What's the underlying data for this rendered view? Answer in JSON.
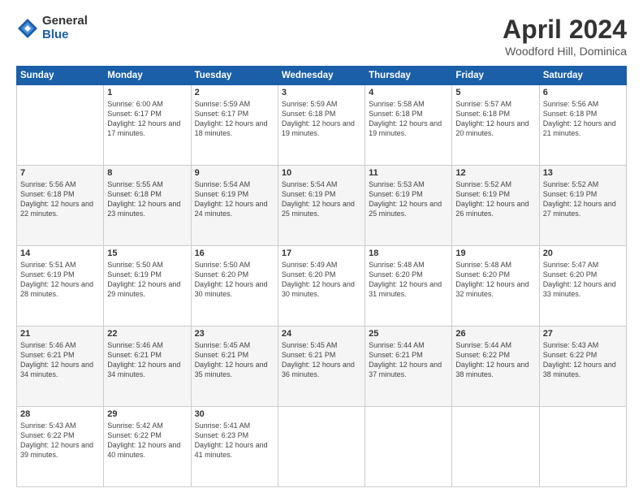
{
  "logo": {
    "general": "General",
    "blue": "Blue"
  },
  "title": {
    "month": "April 2024",
    "location": "Woodford Hill, Dominica"
  },
  "headers": [
    "Sunday",
    "Monday",
    "Tuesday",
    "Wednesday",
    "Thursday",
    "Friday",
    "Saturday"
  ],
  "weeks": [
    [
      {
        "day": "",
        "sunrise": "",
        "sunset": "",
        "daylight": ""
      },
      {
        "day": "1",
        "sunrise": "Sunrise: 6:00 AM",
        "sunset": "Sunset: 6:17 PM",
        "daylight": "Daylight: 12 hours and 17 minutes."
      },
      {
        "day": "2",
        "sunrise": "Sunrise: 5:59 AM",
        "sunset": "Sunset: 6:17 PM",
        "daylight": "Daylight: 12 hours and 18 minutes."
      },
      {
        "day": "3",
        "sunrise": "Sunrise: 5:59 AM",
        "sunset": "Sunset: 6:18 PM",
        "daylight": "Daylight: 12 hours and 19 minutes."
      },
      {
        "day": "4",
        "sunrise": "Sunrise: 5:58 AM",
        "sunset": "Sunset: 6:18 PM",
        "daylight": "Daylight: 12 hours and 19 minutes."
      },
      {
        "day": "5",
        "sunrise": "Sunrise: 5:57 AM",
        "sunset": "Sunset: 6:18 PM",
        "daylight": "Daylight: 12 hours and 20 minutes."
      },
      {
        "day": "6",
        "sunrise": "Sunrise: 5:56 AM",
        "sunset": "Sunset: 6:18 PM",
        "daylight": "Daylight: 12 hours and 21 minutes."
      }
    ],
    [
      {
        "day": "7",
        "sunrise": "Sunrise: 5:56 AM",
        "sunset": "Sunset: 6:18 PM",
        "daylight": "Daylight: 12 hours and 22 minutes."
      },
      {
        "day": "8",
        "sunrise": "Sunrise: 5:55 AM",
        "sunset": "Sunset: 6:18 PM",
        "daylight": "Daylight: 12 hours and 23 minutes."
      },
      {
        "day": "9",
        "sunrise": "Sunrise: 5:54 AM",
        "sunset": "Sunset: 6:19 PM",
        "daylight": "Daylight: 12 hours and 24 minutes."
      },
      {
        "day": "10",
        "sunrise": "Sunrise: 5:54 AM",
        "sunset": "Sunset: 6:19 PM",
        "daylight": "Daylight: 12 hours and 25 minutes."
      },
      {
        "day": "11",
        "sunrise": "Sunrise: 5:53 AM",
        "sunset": "Sunset: 6:19 PM",
        "daylight": "Daylight: 12 hours and 25 minutes."
      },
      {
        "day": "12",
        "sunrise": "Sunrise: 5:52 AM",
        "sunset": "Sunset: 6:19 PM",
        "daylight": "Daylight: 12 hours and 26 minutes."
      },
      {
        "day": "13",
        "sunrise": "Sunrise: 5:52 AM",
        "sunset": "Sunset: 6:19 PM",
        "daylight": "Daylight: 12 hours and 27 minutes."
      }
    ],
    [
      {
        "day": "14",
        "sunrise": "Sunrise: 5:51 AM",
        "sunset": "Sunset: 6:19 PM",
        "daylight": "Daylight: 12 hours and 28 minutes."
      },
      {
        "day": "15",
        "sunrise": "Sunrise: 5:50 AM",
        "sunset": "Sunset: 6:19 PM",
        "daylight": "Daylight: 12 hours and 29 minutes."
      },
      {
        "day": "16",
        "sunrise": "Sunrise: 5:50 AM",
        "sunset": "Sunset: 6:20 PM",
        "daylight": "Daylight: 12 hours and 30 minutes."
      },
      {
        "day": "17",
        "sunrise": "Sunrise: 5:49 AM",
        "sunset": "Sunset: 6:20 PM",
        "daylight": "Daylight: 12 hours and 30 minutes."
      },
      {
        "day": "18",
        "sunrise": "Sunrise: 5:48 AM",
        "sunset": "Sunset: 6:20 PM",
        "daylight": "Daylight: 12 hours and 31 minutes."
      },
      {
        "day": "19",
        "sunrise": "Sunrise: 5:48 AM",
        "sunset": "Sunset: 6:20 PM",
        "daylight": "Daylight: 12 hours and 32 minutes."
      },
      {
        "day": "20",
        "sunrise": "Sunrise: 5:47 AM",
        "sunset": "Sunset: 6:20 PM",
        "daylight": "Daylight: 12 hours and 33 minutes."
      }
    ],
    [
      {
        "day": "21",
        "sunrise": "Sunrise: 5:46 AM",
        "sunset": "Sunset: 6:21 PM",
        "daylight": "Daylight: 12 hours and 34 minutes."
      },
      {
        "day": "22",
        "sunrise": "Sunrise: 5:46 AM",
        "sunset": "Sunset: 6:21 PM",
        "daylight": "Daylight: 12 hours and 34 minutes."
      },
      {
        "day": "23",
        "sunrise": "Sunrise: 5:45 AM",
        "sunset": "Sunset: 6:21 PM",
        "daylight": "Daylight: 12 hours and 35 minutes."
      },
      {
        "day": "24",
        "sunrise": "Sunrise: 5:45 AM",
        "sunset": "Sunset: 6:21 PM",
        "daylight": "Daylight: 12 hours and 36 minutes."
      },
      {
        "day": "25",
        "sunrise": "Sunrise: 5:44 AM",
        "sunset": "Sunset: 6:21 PM",
        "daylight": "Daylight: 12 hours and 37 minutes."
      },
      {
        "day": "26",
        "sunrise": "Sunrise: 5:44 AM",
        "sunset": "Sunset: 6:22 PM",
        "daylight": "Daylight: 12 hours and 38 minutes."
      },
      {
        "day": "27",
        "sunrise": "Sunrise: 5:43 AM",
        "sunset": "Sunset: 6:22 PM",
        "daylight": "Daylight: 12 hours and 38 minutes."
      }
    ],
    [
      {
        "day": "28",
        "sunrise": "Sunrise: 5:43 AM",
        "sunset": "Sunset: 6:22 PM",
        "daylight": "Daylight: 12 hours and 39 minutes."
      },
      {
        "day": "29",
        "sunrise": "Sunrise: 5:42 AM",
        "sunset": "Sunset: 6:22 PM",
        "daylight": "Daylight: 12 hours and 40 minutes."
      },
      {
        "day": "30",
        "sunrise": "Sunrise: 5:41 AM",
        "sunset": "Sunset: 6:23 PM",
        "daylight": "Daylight: 12 hours and 41 minutes."
      },
      {
        "day": "",
        "sunrise": "",
        "sunset": "",
        "daylight": ""
      },
      {
        "day": "",
        "sunrise": "",
        "sunset": "",
        "daylight": ""
      },
      {
        "day": "",
        "sunrise": "",
        "sunset": "",
        "daylight": ""
      },
      {
        "day": "",
        "sunrise": "",
        "sunset": "",
        "daylight": ""
      }
    ]
  ]
}
